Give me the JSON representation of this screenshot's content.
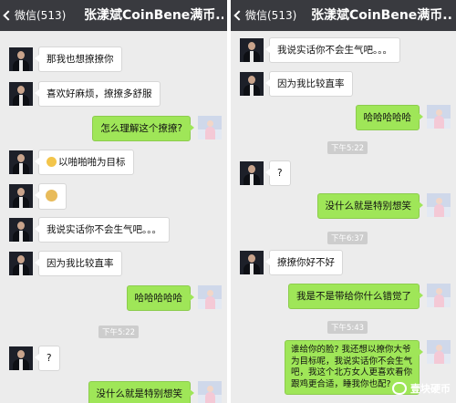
{
  "left": {
    "back_label": "微信(513)",
    "title": "张漾斌CoinBene满币...",
    "messages": [
      "那我也想撩撩你",
      "喜欢好麻烦，撩撩多舒服",
      "怎么理解这个撩撩?",
      "以啪啪啪为目标",
      "我说实话你不会生气吧。。。",
      "因为我比较直率",
      "哈哈哈哈哈",
      "?",
      "没什么就是特别想笑"
    ],
    "time": "下午5:22"
  },
  "right": {
    "back_label": "微信(513)",
    "title": "张漾斌CoinBene满币...",
    "messages": [
      "我说实话你不会生气吧。。。",
      "因为我比较直率",
      "哈哈哈哈哈",
      "?",
      "没什么就是特别想笑",
      "撩撩你好不好",
      "我是不是带给你什么错觉了",
      "谁给你的脸? 我还想以撩你大爷为目标呢，我说实话你不会生气吧，我这个北方女人更喜欢看你跟鸡更合适，睡我你也配?"
    ],
    "times": [
      "下午5:22",
      "下午6:37",
      "下午5:43"
    ]
  },
  "watermark": "壹块硬币",
  "colors": {
    "navbar": "#393a3f",
    "chat_bg": "#ececec",
    "bubble_out": "#9fe658"
  }
}
